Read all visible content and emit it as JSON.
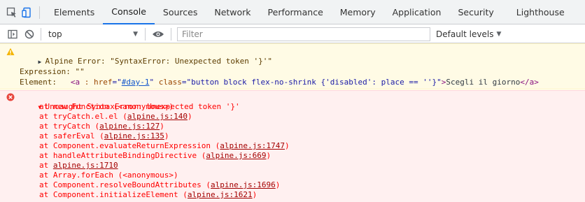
{
  "tabs": [
    {
      "label": "Elements"
    },
    {
      "label": "Console"
    },
    {
      "label": "Sources"
    },
    {
      "label": "Network"
    },
    {
      "label": "Performance"
    },
    {
      "label": "Memory"
    },
    {
      "label": "Application"
    },
    {
      "label": "Security"
    },
    {
      "label": "Lighthouse"
    }
  ],
  "toolbar": {
    "context": "top",
    "filter_placeholder": "Filter",
    "levels_label": "Default levels"
  },
  "colors": {
    "active_tab_underline": "#1a73e8",
    "warning_bg": "#fffbe5",
    "error_bg": "#fff0f0",
    "error_text": "#ff0000"
  },
  "warning": {
    "title": "Alpine Error: \"SyntaxError: Unexpected token '}'\"",
    "expression_label": "Expression: ",
    "expression_value": "\"\"",
    "element_label": "Element:   ",
    "element_tag_open": "<a",
    "element_colon": " : ",
    "element_href_name": "href",
    "element_href_eq": "=\"",
    "element_href_val": "#day-1",
    "element_href_close": "\"",
    "element_class_name": " class",
    "element_class_val": "=\"button block flex-no-shrink {'disabled': place == ''}\"",
    "element_tag_close": ">",
    "element_text": "Scegli il giorno",
    "element_end_tag": "</a>"
  },
  "error": {
    "title": "Uncaught SyntaxError: Unexpected token '}'",
    "stack": [
      {
        "text": "at new Function (<anonymous>)",
        "link": ""
      },
      {
        "text": "at tryCatch.el.el (",
        "link": "alpine.js:140",
        "after": ")"
      },
      {
        "text": "at tryCatch (",
        "link": "alpine.js:127",
        "after": ")"
      },
      {
        "text": "at saferEval (",
        "link": "alpine.js:135",
        "after": ")"
      },
      {
        "text": "at Component.evaluateReturnExpression (",
        "link": "alpine.js:1747",
        "after": ")"
      },
      {
        "text": "at handleAttributeBindingDirective (",
        "link": "alpine.js:669",
        "after": ")"
      },
      {
        "text": "at ",
        "link": "alpine.js:1710",
        "after": ""
      },
      {
        "text": "at Array.forEach (<anonymous>)",
        "link": ""
      },
      {
        "text": "at Component.resolveBoundAttributes (",
        "link": "alpine.js:1696",
        "after": ")"
      },
      {
        "text": "at Component.initializeElement (",
        "link": "alpine.js:1621",
        "after": ")"
      }
    ]
  }
}
